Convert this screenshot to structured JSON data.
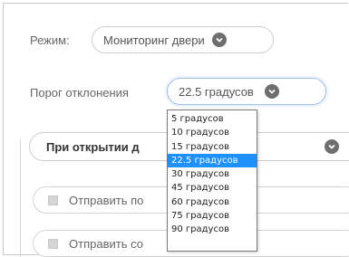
{
  "mode": {
    "label": "Режим:",
    "value": "Мониторинг двери",
    "icon": "chevron-down-icon"
  },
  "threshold": {
    "label": "Порог отклонения",
    "value": "22.5 градусов",
    "icon": "chevron-down-icon"
  },
  "section": {
    "title_visible": "При открытии д",
    "icon": "chevron-down-icon"
  },
  "actions": [
    {
      "label_visible": "Отправить по"
    },
    {
      "label_visible": "Отправить со"
    }
  ],
  "dropdown": {
    "options": [
      "5 градусов",
      "10 градусов",
      "15 градусов",
      "22.5 градусов",
      "30 градусов",
      "45 градусов",
      "60 градусов",
      "75 градусов",
      "90 градусов"
    ],
    "selected": "22.5 градусов"
  },
  "colors": {
    "selection": "#1e90ff",
    "chevron": "#6e6e6e"
  }
}
